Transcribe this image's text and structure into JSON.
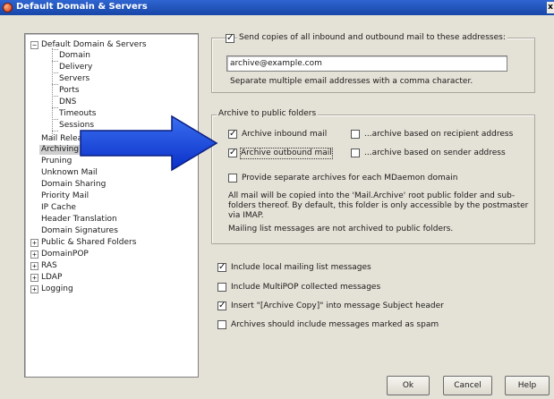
{
  "window": {
    "title": "Default Domain & Servers",
    "close_label": "x"
  },
  "tree": {
    "items": [
      {
        "label": "Default Domain & Servers",
        "expander": "−"
      },
      {
        "label": "Domain"
      },
      {
        "label": "Delivery"
      },
      {
        "label": "Servers"
      },
      {
        "label": "Ports"
      },
      {
        "label": "DNS"
      },
      {
        "label": "Timeouts"
      },
      {
        "label": "Sessions"
      },
      {
        "label": "Mail Release"
      },
      {
        "label": "Archiving",
        "selected": true
      },
      {
        "label": "Pruning"
      },
      {
        "label": "Unknown Mail"
      },
      {
        "label": "Domain Sharing"
      },
      {
        "label": "Priority Mail"
      },
      {
        "label": "IP Cache"
      },
      {
        "label": "Header Translation"
      },
      {
        "label": "Domain Signatures"
      },
      {
        "label": "Public & Shared Folders",
        "expander": "+"
      },
      {
        "label": "DomainPOP",
        "expander": "+"
      },
      {
        "label": "RAS",
        "expander": "+"
      },
      {
        "label": "LDAP",
        "expander": "+"
      },
      {
        "label": "Logging",
        "expander": "+"
      }
    ]
  },
  "copies": {
    "legend": "Send copies of all inbound and outbound mail to these addresses:",
    "checked": true,
    "address_value": "archive@example.com",
    "hint": "Separate multiple email addresses with a comma character."
  },
  "archive_public": {
    "legend": "Archive to public folders",
    "inbound": {
      "label": "Archive inbound mail",
      "checked": true
    },
    "outbound": {
      "label": "Archive outbound mail",
      "checked": true
    },
    "by_recipient": {
      "label": "...archive based on recipient address",
      "checked": false
    },
    "by_sender": {
      "label": "...archive based on sender address",
      "checked": false
    },
    "separate": {
      "label": "Provide separate archives for each MDaemon domain",
      "checked": false
    },
    "info1": "All mail will be copied into the 'Mail.Archive' root public folder and sub-folders thereof.  By default, this folder is only accessible by the postmaster via IMAP.",
    "info2": "Mailing list messages are not archived to public folders."
  },
  "options": {
    "local_lists": {
      "label": "Include local mailing list messages",
      "checked": true
    },
    "multipop": {
      "label": "Include MultiPOP collected messages",
      "checked": false
    },
    "insert_header": {
      "label": "Insert \"[Archive Copy]\" into message Subject header",
      "checked": true
    },
    "spam": {
      "label": "Archives should include messages marked as spam",
      "checked": false
    }
  },
  "buttons": {
    "ok": "Ok",
    "cancel": "Cancel",
    "help": "Help"
  },
  "check_mark": "✓"
}
